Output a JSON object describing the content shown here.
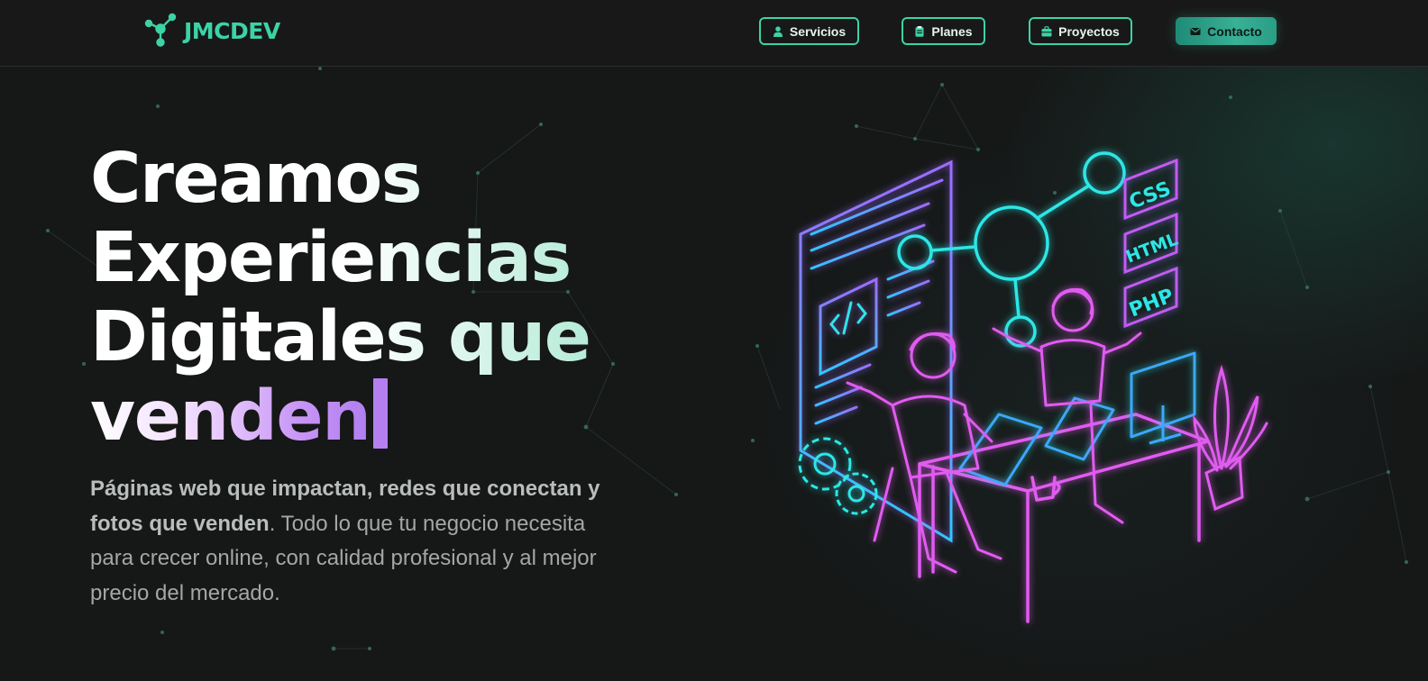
{
  "brand": {
    "name": "JMCDEV",
    "accent": "#3cd3a6"
  },
  "nav": {
    "items": [
      {
        "label": "Servicios",
        "icon": "user-icon"
      },
      {
        "label": "Planes",
        "icon": "clipboard-icon"
      },
      {
        "label": "Proyectos",
        "icon": "briefcase-icon"
      },
      {
        "label": "Contacto",
        "icon": "envelope-icon"
      }
    ]
  },
  "hero": {
    "title_lines": [
      "Creamos",
      "Experiencias",
      "Digitales que",
      "venden"
    ],
    "desc_bold": "Páginas web que impactan, redes que conectan y fotos que venden",
    "desc_rest": ". Todo lo que tu negocio necesita para crecer online, con calidad profesional y al mejor precio del mercado."
  },
  "illustration": {
    "tags": [
      "CSS",
      "HTML",
      "PHP"
    ],
    "colors": {
      "pink": "#e05cf0",
      "cyan": "#2ee6e6",
      "violet": "#8f6bff"
    }
  }
}
